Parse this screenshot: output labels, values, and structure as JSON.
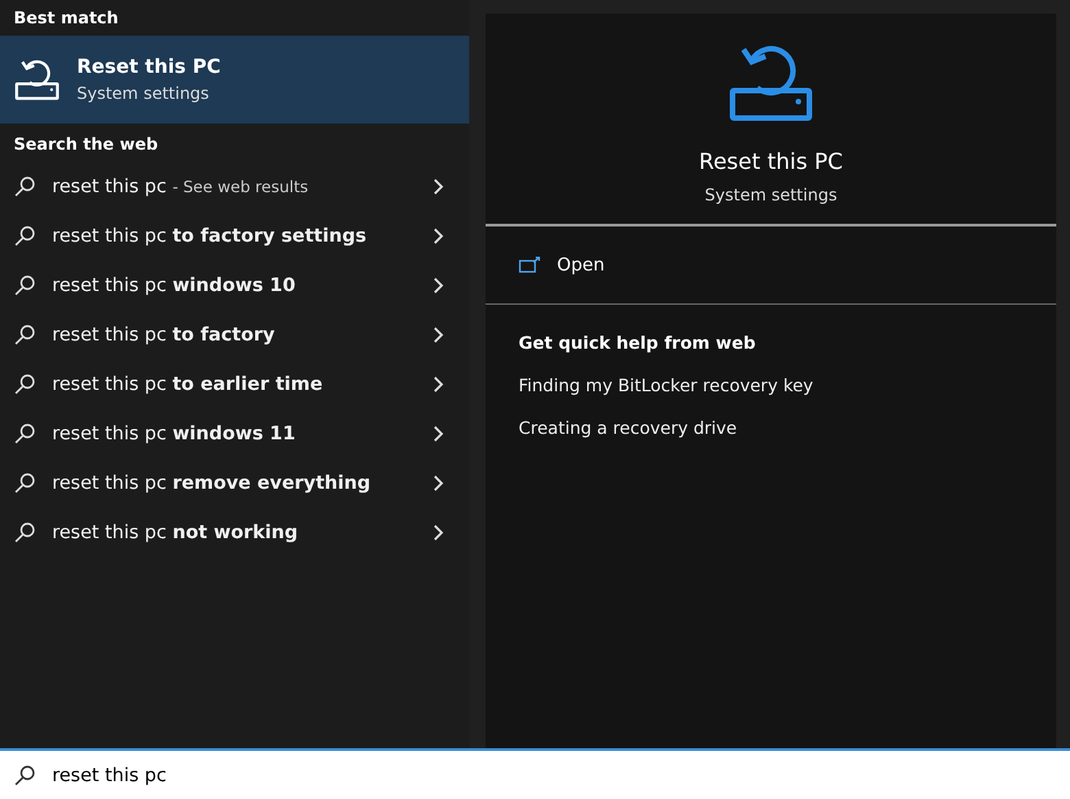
{
  "best_match": {
    "heading": "Best match",
    "item": {
      "title": "Reset this PC",
      "subtitle": "System settings",
      "selected": true
    }
  },
  "web": {
    "heading": "Search the web",
    "suggestions": [
      {
        "text": "reset this pc",
        "hint": "- See web results"
      },
      {
        "text": "reset this pc **to factory settings**"
      },
      {
        "text": "reset this pc **windows 10**"
      },
      {
        "text": "reset this pc **to factory**"
      },
      {
        "text": "reset this pc **to earlier time**"
      },
      {
        "text": "reset this pc **windows 11**"
      },
      {
        "text": "reset this pc **remove everything**"
      },
      {
        "text": "reset this pc **not working**"
      }
    ]
  },
  "preview": {
    "title": "Reset this PC",
    "subtitle": "System settings",
    "actions": [
      "Open"
    ],
    "help": {
      "heading": "Get quick help from web",
      "links": [
        "Finding my BitLocker recovery key",
        "Creating a recovery drive"
      ]
    }
  },
  "search_box": {
    "value": "reset this pc"
  }
}
